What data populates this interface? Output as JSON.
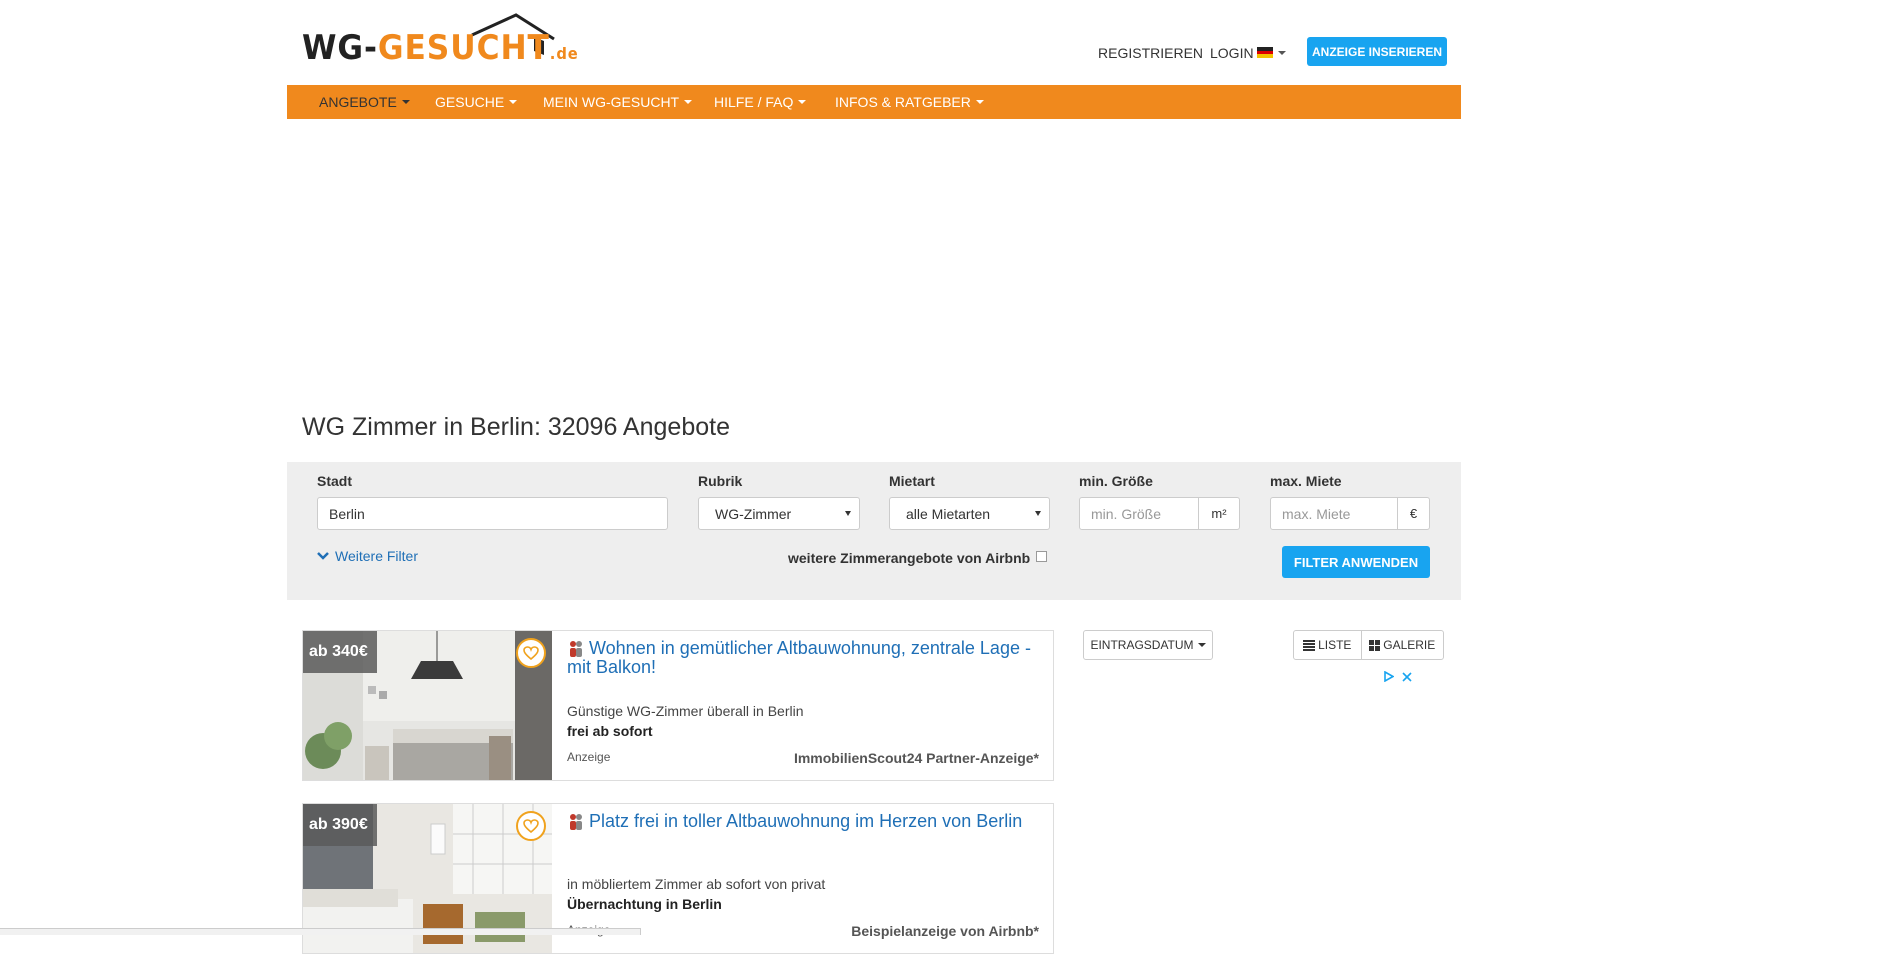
{
  "header": {
    "logo": {
      "main": "WG-GESUCHT",
      "tld": ".de"
    },
    "register_label": "REGISTRIEREN",
    "login_label": "LOGIN",
    "insert_label": "ANZEIGE INSERIEREN"
  },
  "nav": {
    "items": [
      {
        "label": "ANGEBOTE",
        "active": true
      },
      {
        "label": "GESUCHE"
      },
      {
        "label": "MEIN WG-GESUCHT"
      },
      {
        "label": "HILFE / FAQ"
      },
      {
        "label": "INFOS & RATGEBER"
      }
    ]
  },
  "colors": {
    "brand_orange": "#f0891d",
    "accent_blue": "#18a4f0",
    "link_blue": "#1f6fb6"
  },
  "page_title": "WG Zimmer in Berlin: 32096 Angebote",
  "filter": {
    "city_label": "Stadt",
    "city_value": "Berlin",
    "category_label": "Rubrik",
    "category_value": "WG-Zimmer",
    "rent_type_label": "Mietart",
    "rent_type_value": "alle Mietarten",
    "min_size_label": "min. Größe",
    "min_size_placeholder": "min. Größe",
    "min_size_unit": "m²",
    "max_rent_label": "max. Miete",
    "max_rent_placeholder": "max. Miete",
    "max_rent_unit": "€",
    "more_filters_label": "Weitere Filter",
    "airbnb_label": "weitere Zimmerangebote von Airbnb",
    "apply_label": "FILTER ANWENDEN"
  },
  "listings": [
    {
      "price": "ab 340€",
      "title": "Wohnen in gemütlicher Altbauwohnung, zentrale Lage - mit Balkon!",
      "line1": "Günstige WG-Zimmer überall in Berlin",
      "line2": "frei ab sofort",
      "ad_label": "Anzeige",
      "partner": "ImmobilienScout24 Partner-Anzeige*"
    },
    {
      "price": "ab 390€",
      "title": "Platz frei in toller Altbauwohnung im Herzen von Berlin",
      "line1": "in möbliertem Zimmer ab sofort von privat",
      "line2": "Übernachtung in Berlin",
      "ad_label": "Anzeige",
      "partner": "Beispielanzeige von Airbnb*"
    }
  ],
  "sort": {
    "label": "EINTRAGSDATUM"
  },
  "view": {
    "list_label": "LISTE",
    "gallery_label": "GALERIE"
  },
  "icons": [
    "house-roof-icon",
    "flag-de-icon",
    "chevron-down-icon",
    "heart-icon",
    "people-icon",
    "list-icon",
    "grid-icon",
    "adchoices-icon",
    "close-icon"
  ]
}
